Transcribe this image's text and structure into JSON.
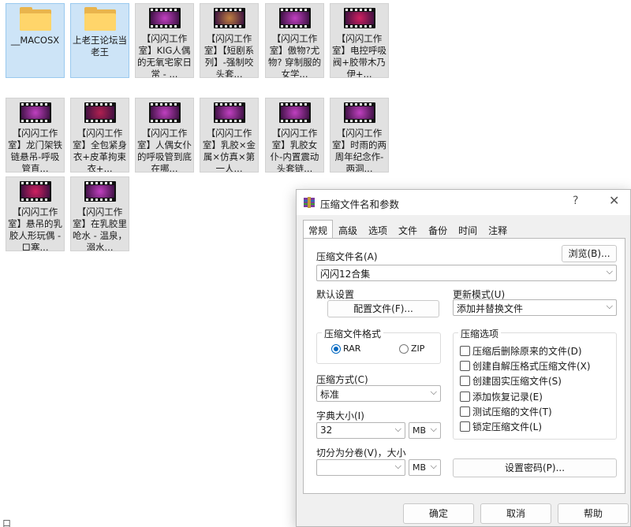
{
  "explorer": {
    "folders": [
      {
        "name": "__MACOSX"
      },
      {
        "name": "上老王论坛当老王"
      }
    ],
    "videos": [
      {
        "name": "【闪闪工作室】KIG人偶的无氧宅家日常 - ...",
        "tint": "#c040c0"
      },
      {
        "name": "【闪闪工作室】【短剧系列】-强制咬头套...",
        "tint": "#c08040"
      },
      {
        "name": "【闪闪工作室】傲物?尤物? 穿制服的女学...",
        "tint": "#c040c0"
      },
      {
        "name": "【闪闪工作室】电控呼吸阀+胶带木乃伊+...",
        "tint": "#d02060"
      },
      {
        "name": "【闪闪工作室】龙门架铁链悬吊-呼吸管直...",
        "tint": "#c040c0"
      },
      {
        "name": "【闪闪工作室】全包紧身衣+皮革拘束衣+...",
        "tint": "#b02050"
      },
      {
        "name": "【闪闪工作室】人偶女仆的呼吸管到底在哪...",
        "tint": "#c040c0"
      },
      {
        "name": "【闪闪工作室】乳胶×金属×仿真×第一人...",
        "tint": "#c040c0"
      },
      {
        "name": "【闪闪工作室】乳胶女仆-内置震动头套链...",
        "tint": "#c040c0"
      },
      {
        "name": "【闪闪工作室】时雨的两周年纪念作-两洞...",
        "tint": "#c040c0"
      },
      {
        "name": "【闪闪工作室】悬吊的乳胶人形玩偶 - 口塞...",
        "tint": "#d02060"
      },
      {
        "name": "【闪闪工作室】在乳胶里呛水 - 温泉，溺水...",
        "tint": "#c040c0"
      }
    ],
    "status_fragment": "口"
  },
  "dialog": {
    "title": "压缩文件名和参数",
    "help_glyph": "?",
    "close_glyph": "✕",
    "tabs": [
      "常规",
      "高级",
      "选项",
      "文件",
      "备份",
      "时间",
      "注释"
    ],
    "archive_name_label": "压缩文件名(A)",
    "browse_label": "浏览(B)...",
    "archive_name_value": "闪闪12合集",
    "default_settings_label": "默认设置",
    "profiles_label": "配置文件(F)...",
    "update_mode_label": "更新模式(U)",
    "update_mode_value": "添加并替换文件",
    "format_group_label": "压缩文件格式",
    "format_rar": "RAR",
    "format_zip": "ZIP",
    "options_group_label": "压缩选项",
    "options": [
      "压缩后删除原来的文件(D)",
      "创建自解压格式压缩文件(X)",
      "创建固实压缩文件(S)",
      "添加恢复记录(E)",
      "测试压缩的文件(T)",
      "锁定压缩文件(L)"
    ],
    "method_label": "压缩方式(C)",
    "method_value": "标准",
    "dict_label": "字典大小(I)",
    "dict_value": "32",
    "dict_unit": "MB",
    "split_label": "切分为分卷(V)，大小",
    "split_value": "",
    "split_unit": "MB",
    "password_label": "设置密码(P)...",
    "ok_label": "确定",
    "cancel_label": "取消",
    "help_label": "帮助"
  }
}
